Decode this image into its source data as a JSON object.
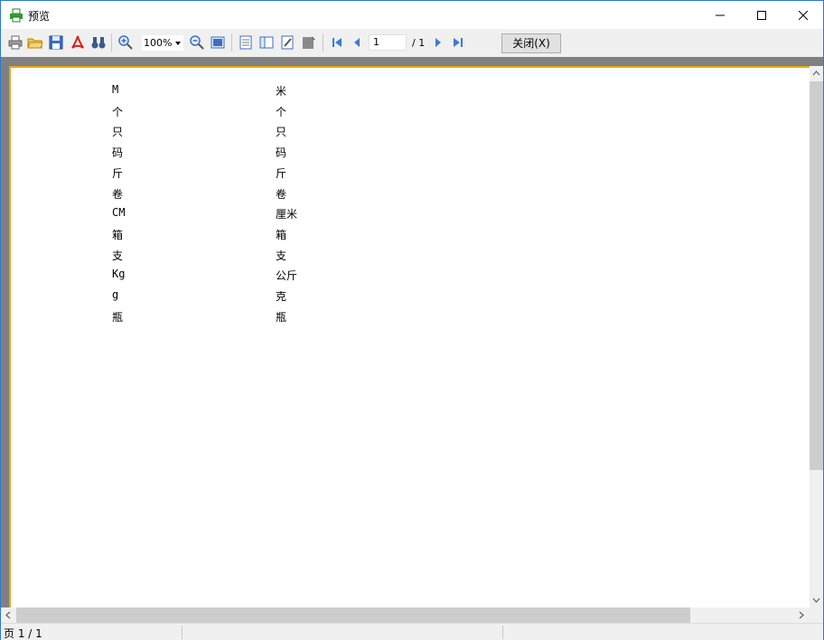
{
  "window": {
    "title": "预览"
  },
  "toolbar": {
    "zoom_value": "100%",
    "page_current": "1",
    "page_total": "/ 1",
    "close_label": "关闭(X)"
  },
  "report": {
    "rows": [
      {
        "code": "M",
        "name": "米"
      },
      {
        "code": "个",
        "name": "个"
      },
      {
        "code": "只",
        "name": "只"
      },
      {
        "code": "码",
        "name": "码"
      },
      {
        "code": "斤",
        "name": "斤"
      },
      {
        "code": "卷",
        "name": "卷"
      },
      {
        "code": "CM",
        "name": "厘米"
      },
      {
        "code": "箱",
        "name": "箱"
      },
      {
        "code": "支",
        "name": "支"
      },
      {
        "code": "Kg",
        "name": "公斤"
      },
      {
        "code": "g",
        "name": "克"
      },
      {
        "code": "瓶",
        "name": "瓶"
      }
    ]
  },
  "statusbar": {
    "page_info": "页 1 / 1"
  },
  "colors": {
    "page_border": "#e6a817",
    "preview_bg": "#808080",
    "accent": "#2b79d0"
  }
}
